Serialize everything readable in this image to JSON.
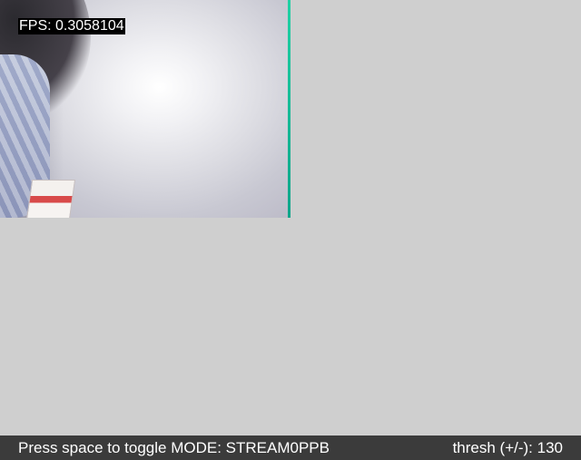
{
  "preview": {
    "fps_text": "FPS: 0.3058104"
  },
  "status_bar": {
    "mode_text": "Press space to toggle MODE: STREAM0PPB",
    "threshold_text": "thresh (+/-): 130"
  },
  "colors": {
    "background": "#cfcfcf",
    "status_bar": "#3b3b3b",
    "text": "#ffffff",
    "frame_edge": "#1fd1a4"
  }
}
